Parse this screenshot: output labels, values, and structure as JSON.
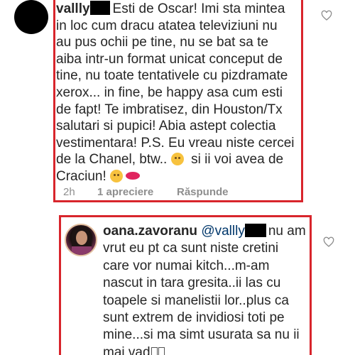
{
  "comments": [
    {
      "username": "vallly",
      "lines": [
        "Esti de Oscar! Imi sta mintea",
        "in loc cum dracu atatea televiziuni nu",
        "au pus ochii pe tine, nu se bat sa te",
        "aiba intr-un format unicat conceput de",
        "tine, nu toate tentativele cu pizdramate",
        "xerox... in fine, be happy asa cum esti",
        "de fapt! Te imbratisez, din Houston/Tx",
        "salutari si pupici! Abia astept colectia",
        "vestimentara! P.S. Eu vreau niste cercei",
        "de la Chanel, btw..",
        "si ii voi avea de",
        "Craciun!"
      ],
      "time": "2h",
      "likes": "1 apreciere",
      "reply_label": "Răspunde"
    },
    {
      "username": "oana.zavoranu",
      "mention": "@vallly",
      "lines": [
        "nu am",
        "vrut eu pt ca sunt niste cretini",
        "care vor numai kitch...m-am",
        "nascut in tara gresita..ii las cu",
        "toapele si manelistii lor..plus ca",
        "sunt extrem de invidiosi toti pe",
        "mine...si ma simt usurata sa nu ii",
        "mai vad"
      ]
    }
  ],
  "icons": {
    "like": "heart-outline-icon",
    "emoji_flushed": "flushed-face-emoji",
    "emoji_hug": "hugging-face-emoji",
    "emoji_lips": "kiss-mark-emoji"
  },
  "colors": {
    "highlight_border": "#d8252c",
    "text": "#262626",
    "meta": "#8e8e8e",
    "mention": "#00376b"
  }
}
